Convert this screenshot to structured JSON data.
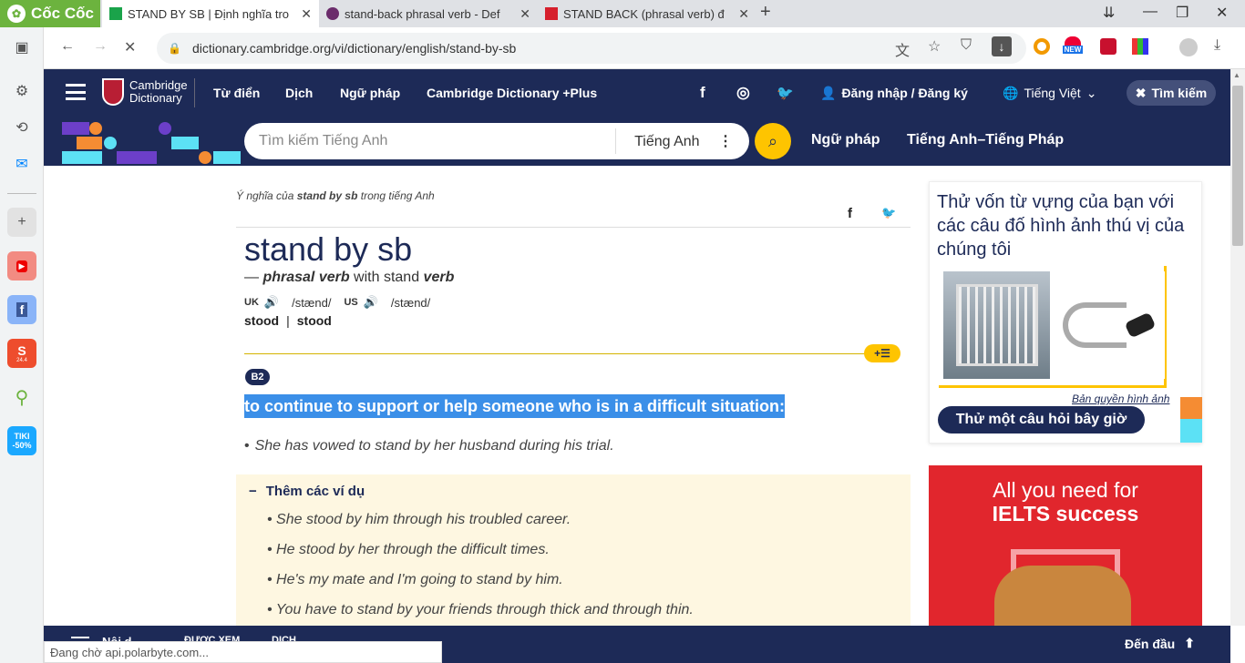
{
  "browser": {
    "brand": "Cốc Cốc",
    "tabs": [
      {
        "title": "STAND BY SB | Định nghĩa tro",
        "active": true
      },
      {
        "title": "stand-back phrasal verb - Def",
        "active": false
      },
      {
        "title": "STAND BACK (phrasal verb) đ",
        "active": false
      }
    ],
    "url": "dictionary.cambridge.org/vi/dictionary/english/stand-by-sb",
    "status": "Đang chờ api.polarbyte.com...",
    "new_badge": "NEW",
    "sidebar_badges": {
      "shopee": "24.4",
      "tiki": "TIKI",
      "tiki_sale": "-50%"
    }
  },
  "site": {
    "logo_line1": "Cambridge",
    "logo_line2": "Dictionary",
    "nav": [
      "Từ điển",
      "Dịch",
      "Ngữ pháp",
      "Cambridge Dictionary +Plus"
    ],
    "login": "Đăng nhập / Đăng ký",
    "language": "Tiếng Việt",
    "search_label": "Tìm kiếm",
    "search_placeholder": "Tìm kiếm Tiếng Anh",
    "search_lang": "Tiếng Anh",
    "search_links": [
      "Ngữ pháp",
      "Tiếng Anh–Tiếng Pháp"
    ]
  },
  "entry": {
    "crumb_prefix": "Ý nghĩa của ",
    "crumb_word": "stand by sb",
    "crumb_suffix": " trong tiếng Anh",
    "headword": "stand by sb",
    "pos_dash": "— ",
    "pos": "phrasal verb",
    "pos_with": " with stand ",
    "pos_verb": "verb",
    "uk": "UK",
    "uk_ipa": "/stænd/",
    "us": "US",
    "us_ipa": "/stænd/",
    "form1": "stood",
    "form_sep": "|",
    "form2": "stood",
    "level": "B2",
    "definition": "to continue to support or help someone who is in a difficult situation:",
    "example": "She has vowed to stand by her husband during his trial.",
    "more_label": "Thêm các ví dụ",
    "more_examples": [
      "She stood by him through his troubled career.",
      "He stood by her through the difficult times.",
      "He's my mate and I'm going to stand by him.",
      "You have to stand by your friends through thick and through thin."
    ]
  },
  "sidebar_quiz": {
    "title": "Thử vốn từ vựng của bạn với các câu đố hình ảnh thú vị của chúng tôi",
    "credit": "Bản quyền hình ảnh",
    "button": "Thử một câu hỏi bây giờ"
  },
  "ad": {
    "line1": "All you need for",
    "line2": "IELTS success"
  },
  "bottom": {
    "back_to_top": "Đến đầu",
    "menu_labels": [
      "Nội d…",
      "ĐƯỢC XEM",
      "DỊCH"
    ]
  },
  "colors": {
    "navy": "#1d2a57",
    "yellow": "#fec400",
    "highlight": "#3b8fe8",
    "ad_red": "#e1262d"
  }
}
